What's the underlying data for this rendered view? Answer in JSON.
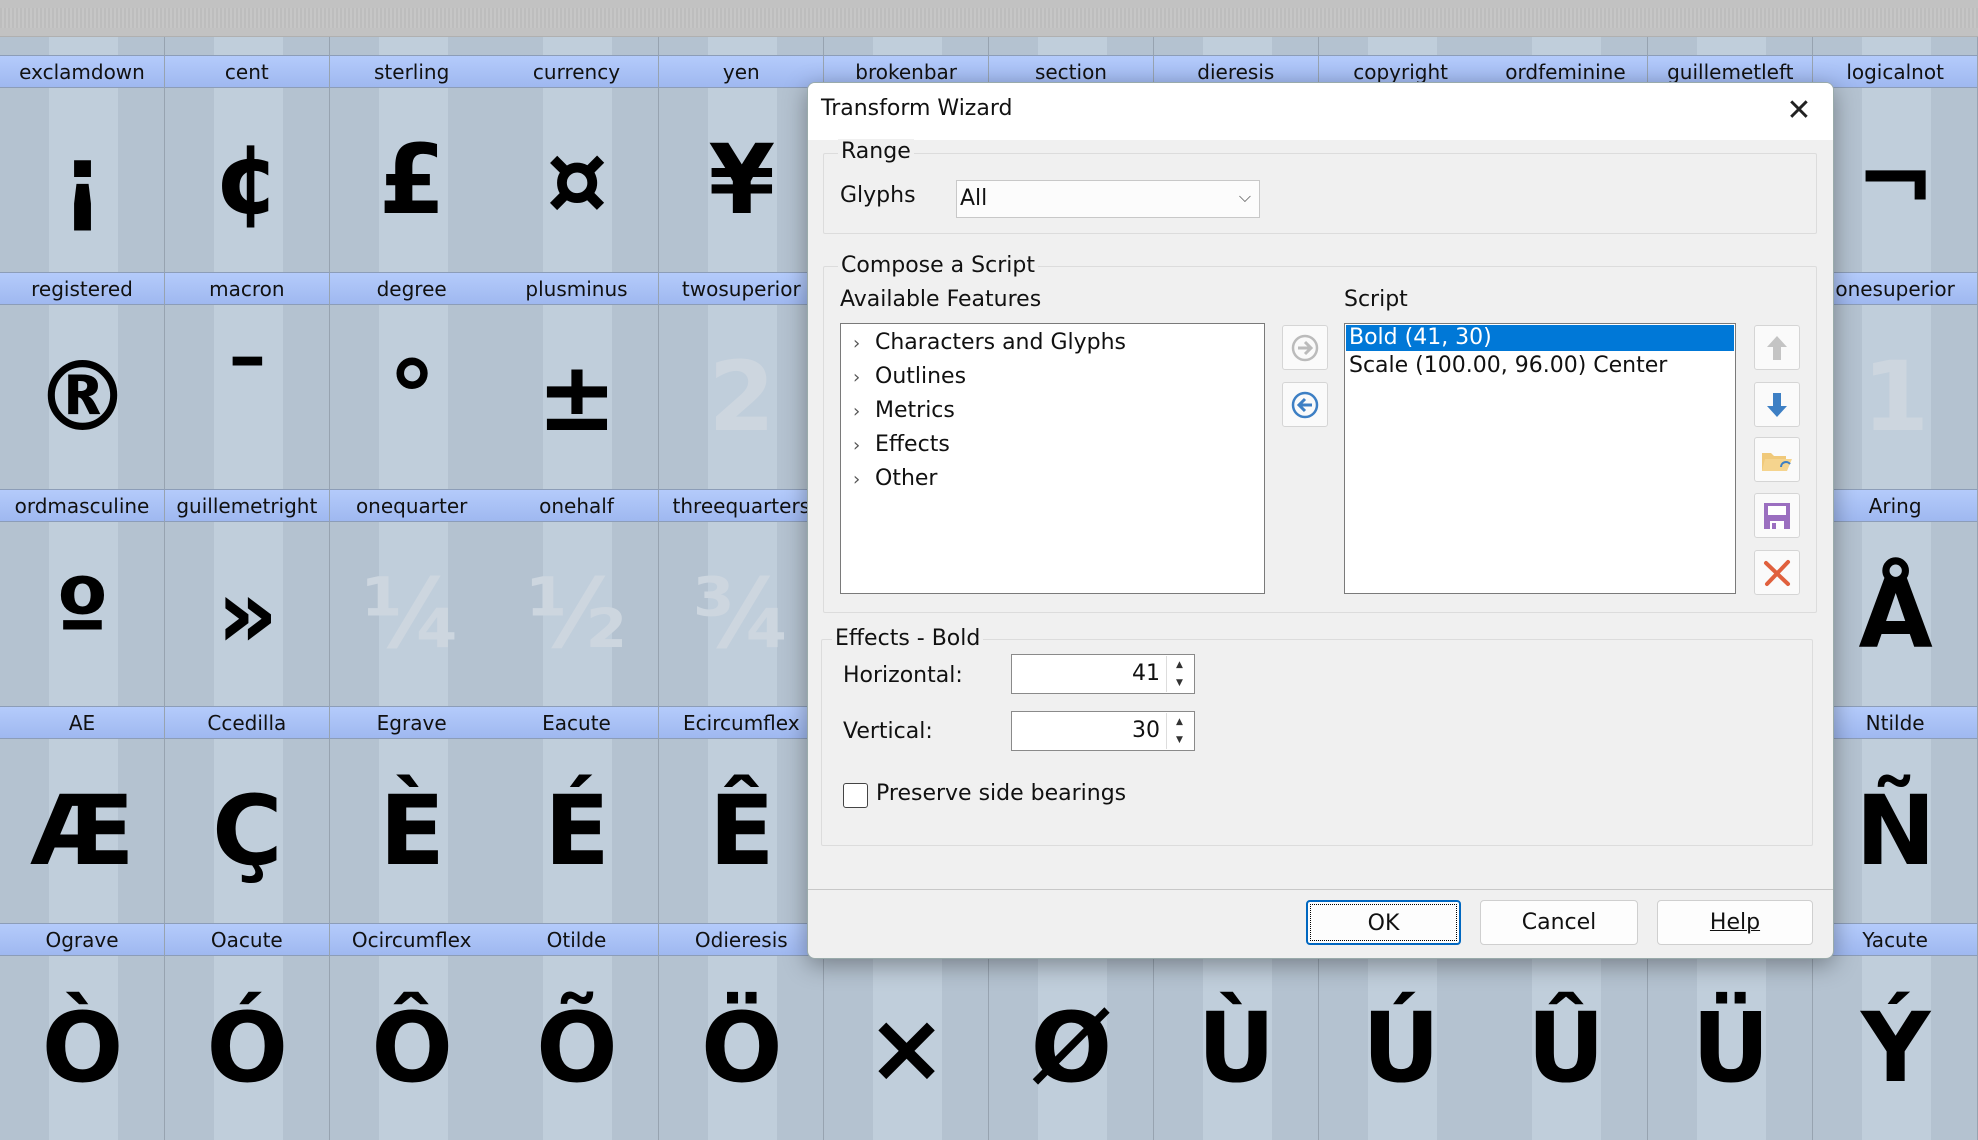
{
  "glyph_grid": {
    "rows": [
      [
        {
          "name": "exclamdown",
          "glyph": "¡"
        },
        {
          "name": "cent",
          "glyph": "¢"
        },
        {
          "name": "sterling",
          "glyph": "£"
        },
        {
          "name": "currency",
          "glyph": "¤"
        },
        {
          "name": "yen",
          "glyph": "¥"
        },
        {
          "name": "brokenbar",
          "glyph": ""
        },
        {
          "name": "section",
          "glyph": ""
        },
        {
          "name": "dieresis",
          "glyph": ""
        },
        {
          "name": "copyright",
          "glyph": ""
        },
        {
          "name": "ordfeminine",
          "glyph": ""
        },
        {
          "name": "guillemetleft",
          "glyph": ""
        },
        {
          "name": "logicalnot",
          "glyph": "¬"
        }
      ],
      [
        {
          "name": "registered",
          "glyph": "®"
        },
        {
          "name": "macron",
          "glyph": "¯"
        },
        {
          "name": "degree",
          "glyph": "°"
        },
        {
          "name": "plusminus",
          "glyph": "±"
        },
        {
          "name": "twosuperior",
          "glyph": "2",
          "placeholder": true
        },
        {
          "name": "",
          "glyph": ""
        },
        {
          "name": "",
          "glyph": ""
        },
        {
          "name": "",
          "glyph": ""
        },
        {
          "name": "",
          "glyph": ""
        },
        {
          "name": "",
          "glyph": ""
        },
        {
          "name": "",
          "glyph": ""
        },
        {
          "name": "onesuperior",
          "glyph": "1",
          "placeholder": true
        }
      ],
      [
        {
          "name": "ordmasculine",
          "glyph": "º"
        },
        {
          "name": "guillemetright",
          "glyph": "»"
        },
        {
          "name": "onequarter",
          "glyph": "¼",
          "placeholder": true
        },
        {
          "name": "onehalf",
          "glyph": "½",
          "placeholder": true
        },
        {
          "name": "threequarters",
          "glyph": "¾",
          "placeholder": true
        },
        {
          "name": "",
          "glyph": ""
        },
        {
          "name": "",
          "glyph": ""
        },
        {
          "name": "",
          "glyph": ""
        },
        {
          "name": "",
          "glyph": ""
        },
        {
          "name": "",
          "glyph": ""
        },
        {
          "name": "",
          "glyph": ""
        },
        {
          "name": "Aring",
          "glyph": "Å"
        }
      ],
      [
        {
          "name": "AE",
          "glyph": "Æ"
        },
        {
          "name": "Ccedilla",
          "glyph": "Ç"
        },
        {
          "name": "Egrave",
          "glyph": "È"
        },
        {
          "name": "Eacute",
          "glyph": "É"
        },
        {
          "name": "Ecircumflex",
          "glyph": "Ê"
        },
        {
          "name": "",
          "glyph": ""
        },
        {
          "name": "",
          "glyph": ""
        },
        {
          "name": "",
          "glyph": ""
        },
        {
          "name": "",
          "glyph": ""
        },
        {
          "name": "",
          "glyph": ""
        },
        {
          "name": "",
          "glyph": ""
        },
        {
          "name": "Ntilde",
          "glyph": "Ñ"
        }
      ],
      [
        {
          "name": "Ograve",
          "glyph": "Ò"
        },
        {
          "name": "Oacute",
          "glyph": "Ó"
        },
        {
          "name": "Ocircumflex",
          "glyph": "Ô"
        },
        {
          "name": "Otilde",
          "glyph": "Õ"
        },
        {
          "name": "Odieresis",
          "glyph": "Ö"
        },
        {
          "name": "",
          "glyph": "×"
        },
        {
          "name": "",
          "glyph": "Ø"
        },
        {
          "name": "",
          "glyph": "Ù"
        },
        {
          "name": "",
          "glyph": "Ú"
        },
        {
          "name": "",
          "glyph": "Û"
        },
        {
          "name": "",
          "glyph": "Ü"
        },
        {
          "name": "Yacute",
          "glyph": "Ý"
        }
      ]
    ]
  },
  "dialog": {
    "title": "Transform Wizard",
    "range": {
      "heading": "Range",
      "glyphs_label": "Glyphs",
      "glyphs_value": "All"
    },
    "compose": {
      "heading": "Compose a Script",
      "available_label": "Available Features",
      "features": [
        "Characters and Glyphs",
        "Outlines",
        "Metrics",
        "Effects",
        "Other"
      ],
      "script_label": "Script",
      "script_items": [
        "Bold (41, 30)",
        "Scale (100.00, 96.00) Center"
      ],
      "selected_index": 0
    },
    "effects": {
      "heading": "Effects - Bold",
      "horizontal_label": "Horizontal:",
      "horizontal_value": "41",
      "vertical_label": "Vertical:",
      "vertical_value": "30",
      "preserve_label": "Preserve side bearings",
      "preserve_checked": false
    },
    "buttons": {
      "ok": "OK",
      "cancel": "Cancel",
      "help": "Help"
    }
  },
  "colors": {
    "selection": "#0078d7",
    "header": "#a9c1f5"
  }
}
